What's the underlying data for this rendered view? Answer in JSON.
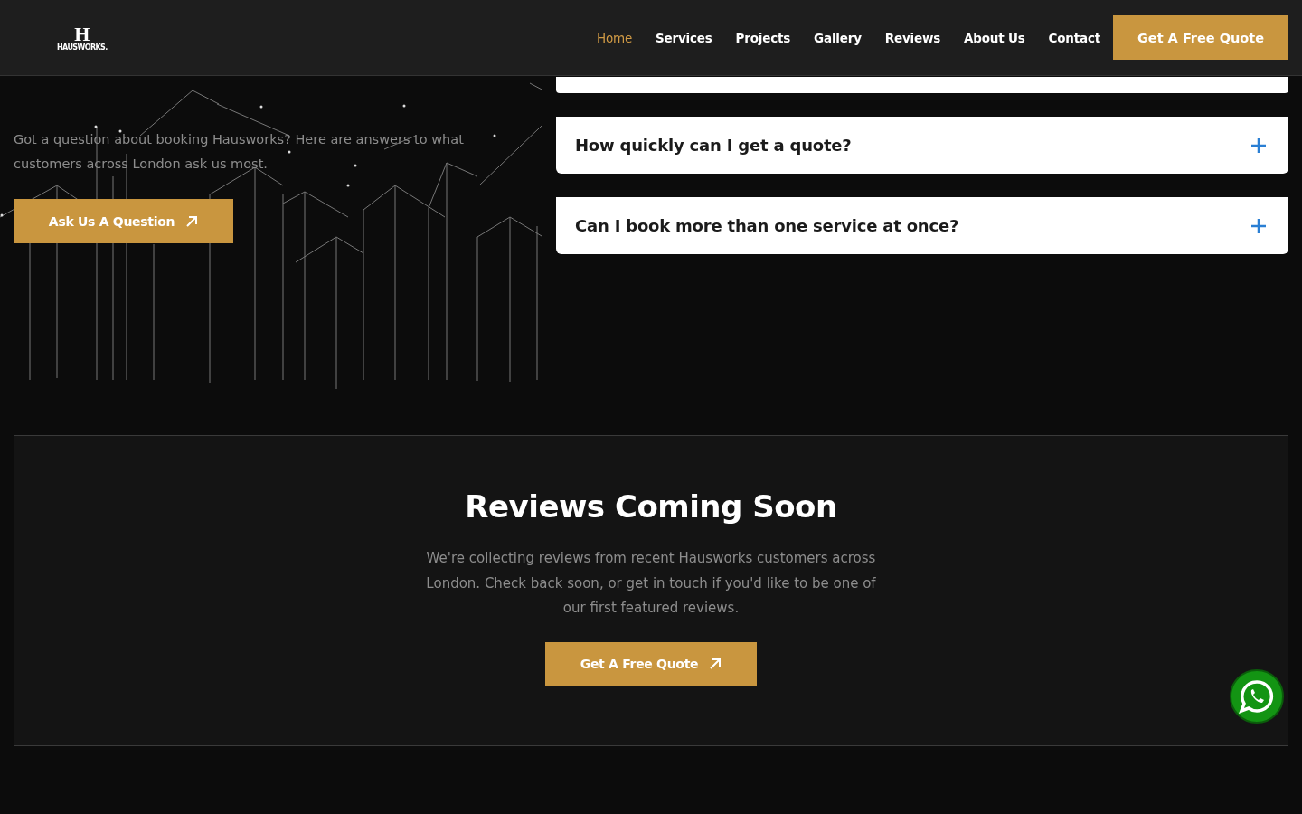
{
  "header": {
    "logo": {
      "mark": "H",
      "wordmark": "HAUSWORKS."
    },
    "nav": [
      {
        "label": "Home",
        "selected": true
      },
      {
        "label": "Services",
        "selected": false
      },
      {
        "label": "Projects",
        "selected": false
      },
      {
        "label": "Gallery",
        "selected": false
      },
      {
        "label": "Reviews",
        "selected": false
      },
      {
        "label": "About Us",
        "selected": false
      },
      {
        "label": "Contact",
        "selected": false
      }
    ],
    "cta": "Get A Free Quote"
  },
  "faq": {
    "intro": "Got a question about booking Hausworks? Here are answers to what customers across London ask us most.",
    "button": "Ask Us A Question",
    "items": [
      {
        "question": "How quickly can I get a quote?",
        "expanded": false
      },
      {
        "question": "Can I book more than one service at once?",
        "expanded": false
      }
    ]
  },
  "reviews": {
    "title": "Reviews Coming Soon",
    "text": "We're collecting reviews from recent Hausworks customers across London. Check back soon, or get in touch if you'd like to be one of our first featured reviews.",
    "button": "Get A Free Quote"
  }
}
